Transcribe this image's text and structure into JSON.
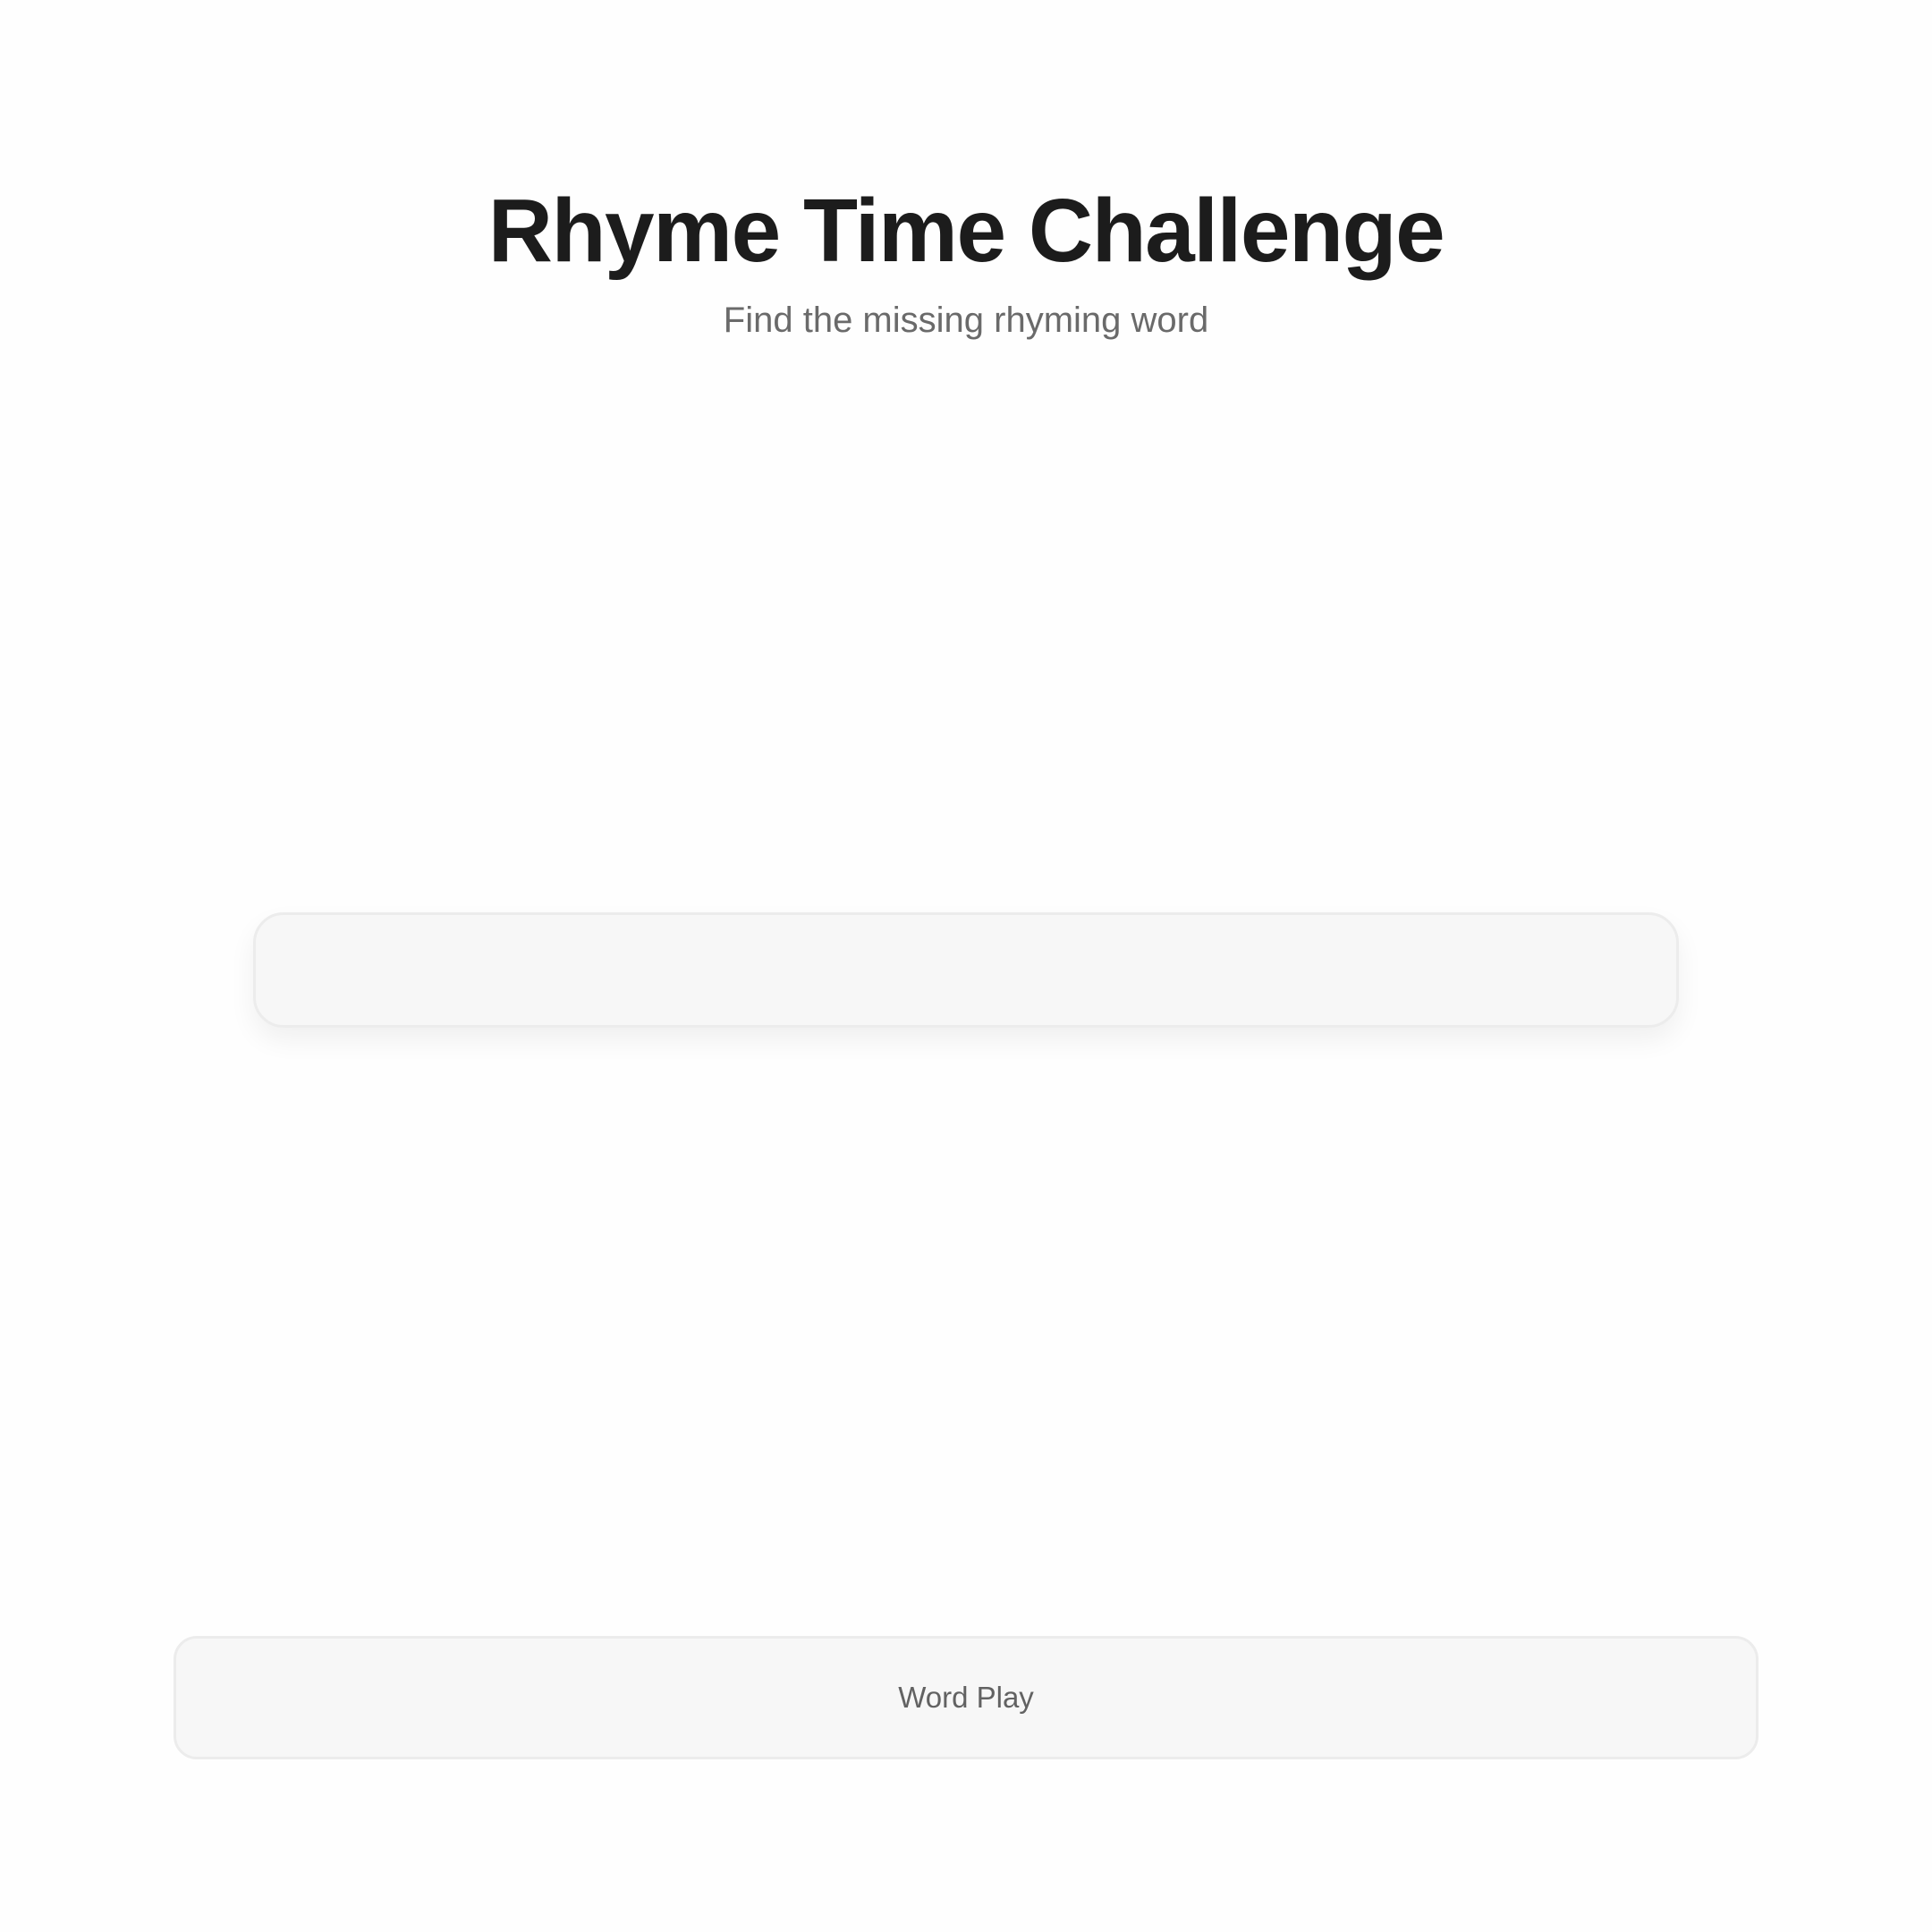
{
  "header": {
    "title": "Rhyme Time Challenge",
    "subtitle": "Find the missing rhyming word"
  },
  "answer": {
    "value": ""
  },
  "footer": {
    "category_label": "Word Play"
  }
}
